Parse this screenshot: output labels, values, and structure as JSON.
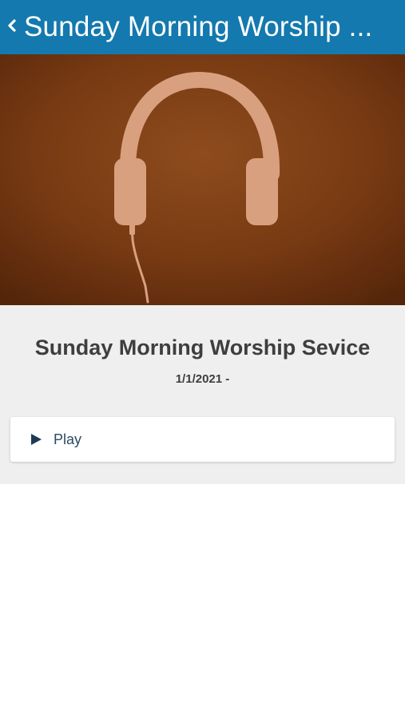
{
  "header": {
    "title": "Sunday Morning Worship ...",
    "back_icon": "chevron-left-icon"
  },
  "hero": {
    "image": "headphones-artwork",
    "background_color": "#7a3c14",
    "art_color": "#d9a07f"
  },
  "media": {
    "title": "Sunday Morning Worship Sevice",
    "date": "1/1/2021 -"
  },
  "actions": {
    "play_label": "Play",
    "play_icon": "play-icon"
  },
  "colors": {
    "header_bg": "#1479ae",
    "info_bg": "#efefef",
    "text_dark": "#3e3e3e",
    "play_text": "#2b4a63"
  }
}
